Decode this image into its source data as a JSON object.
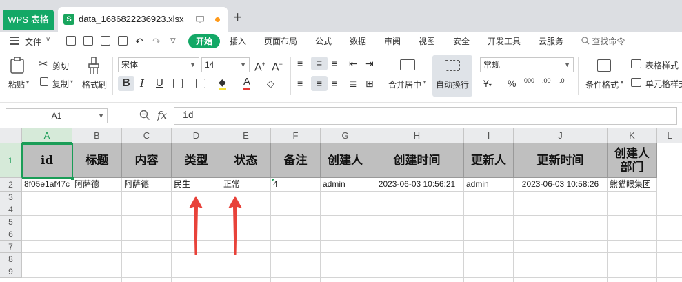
{
  "titlebar": {
    "app_tab": "WPS 表格",
    "file_tab": "data_1686822236923.xlsx",
    "file_icon": "S"
  },
  "menu": {
    "file_label": "文件",
    "items": [
      "开始",
      "插入",
      "页面布局",
      "公式",
      "数据",
      "审阅",
      "视图",
      "安全",
      "开发工具",
      "云服务"
    ],
    "search_label": "查找命令"
  },
  "ribbon": {
    "paste": "粘贴",
    "cut": "剪切",
    "copy": "复制",
    "format_painter": "格式刷",
    "font_name": "宋体",
    "font_size": "14",
    "merge_center": "合并居中",
    "wrap_text": "自动换行",
    "number_format": "常规",
    "conditional_format": "条件格式",
    "table_style": "表格样式",
    "cell_style": "单元格样式",
    "bold": "B",
    "italic": "I",
    "underline": "U",
    "increase_font": "A",
    "decrease_font": "A",
    "currency": "¥",
    "percent": "%",
    "thousands": "000",
    "inc_decimal": ".00",
    "dec_decimal": ".0"
  },
  "formula_bar": {
    "cell_ref": "A1",
    "fx": "fx",
    "value": "id"
  },
  "sheet": {
    "columns": [
      "A",
      "B",
      "C",
      "D",
      "E",
      "F",
      "G",
      "H",
      "I",
      "J",
      "K",
      "L"
    ],
    "row_numbers": [
      "1",
      "2",
      "3",
      "4",
      "5",
      "6",
      "7",
      "8",
      "9"
    ],
    "header_row": [
      "id",
      "标题",
      "内容",
      "类型",
      "状态",
      "备注",
      "创建人",
      "创建时间",
      "更新人",
      "更新时间",
      "创建人部门"
    ],
    "data_row": [
      "8f05e1af47c",
      "阿萨德",
      "阿萨德",
      "民生",
      "正常",
      "4",
      "admin",
      "2023-06-03 10:56:21",
      "admin",
      "2023-06-03 10:58:26",
      "熊猫眼集团"
    ]
  },
  "colors": {
    "accent": "#13a866",
    "header_fill": "#bfbfbf",
    "annotation_arrow": "#e8423a"
  }
}
